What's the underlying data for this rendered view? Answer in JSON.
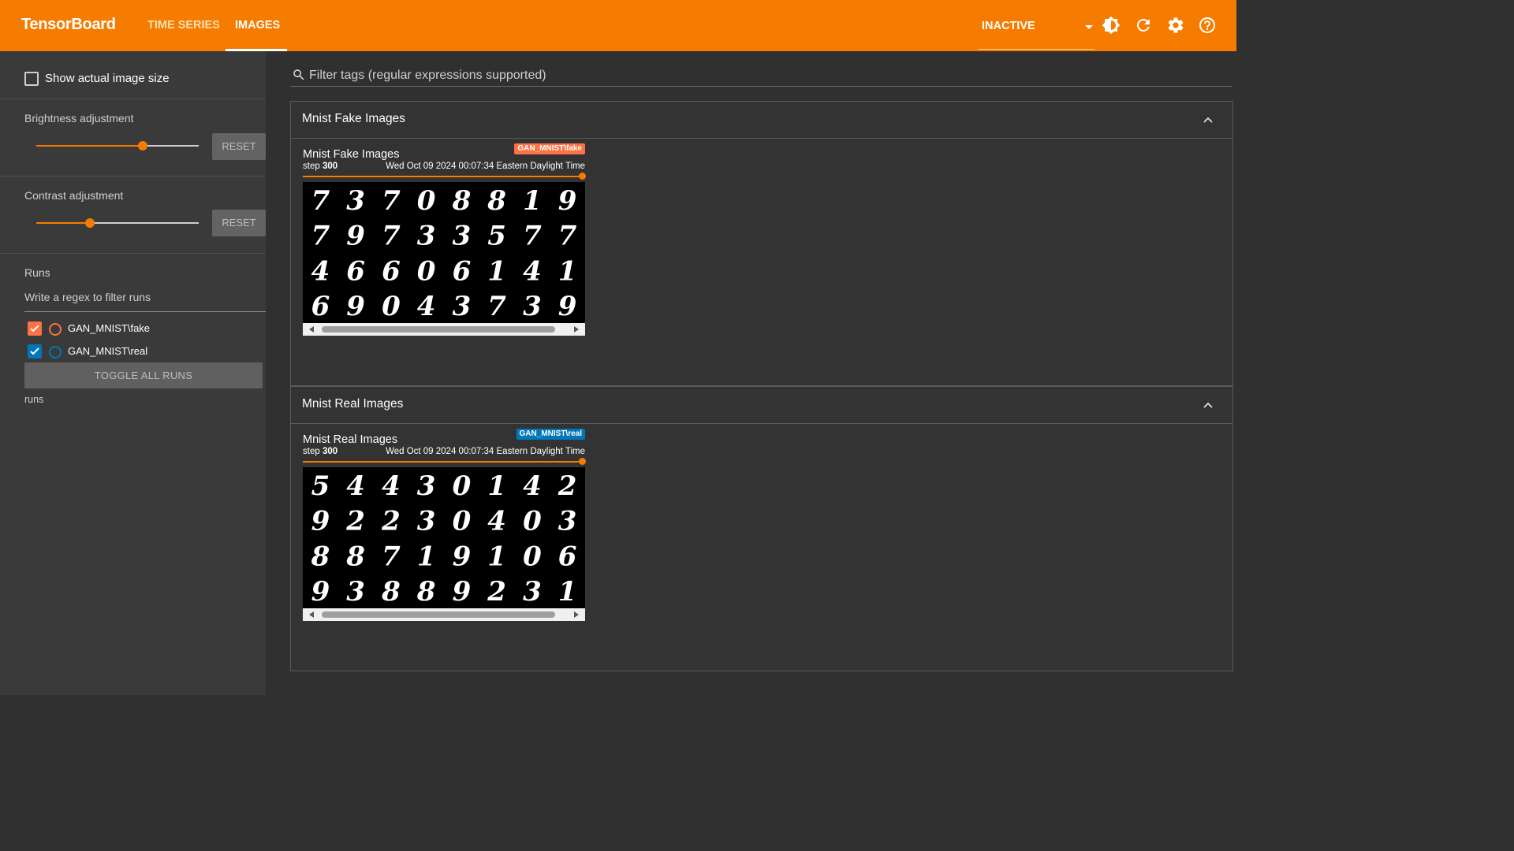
{
  "topbar": {
    "brand": "TensorBoard",
    "tabs": [
      "TIME SERIES",
      "IMAGES"
    ],
    "active_tab": "IMAGES",
    "reload_status": "INACTIVE",
    "icons": [
      "theme-toggle-icon",
      "refresh-icon",
      "settings-icon",
      "help-icon"
    ]
  },
  "sidebar": {
    "show_actual_size_label": "Show actual image size",
    "show_actual_size_checked": false,
    "brightness": {
      "label": "Brightness adjustment",
      "value": 0.65,
      "reset_label": "RESET"
    },
    "contrast": {
      "label": "Contrast adjustment",
      "value": 0.33,
      "reset_label": "RESET"
    },
    "runs": {
      "title": "Runs",
      "filter_placeholder": "Write a regex to filter runs",
      "items": [
        {
          "name": "GAN_MNIST\\fake",
          "checked": true,
          "color": "#ff7043"
        },
        {
          "name": "GAN_MNIST\\real",
          "checked": true,
          "color": "#0077bb"
        }
      ],
      "toggle_label": "TOGGLE ALL RUNS",
      "footer": "runs"
    }
  },
  "main": {
    "filter_placeholder": "Filter tags (regular expressions supported)",
    "groups": [
      {
        "title": "Mnist Fake Images",
        "card": {
          "title": "Mnist Fake Images",
          "run": "GAN_MNIST\\fake",
          "run_color": "#ff7043",
          "step_label": "step",
          "step": "300",
          "timestamp": "Wed Oct 09 2024 00:07:34 Eastern Daylight Time",
          "digits": [
            [
              "7",
              "3",
              "7",
              "0",
              "8",
              "8",
              "1",
              "9"
            ],
            [
              "7",
              "9",
              "7",
              "3",
              "3",
              "5",
              "7",
              "7"
            ],
            [
              "4",
              "6",
              "6",
              "0",
              "6",
              "1",
              "4",
              "1"
            ],
            [
              "6",
              "9",
              "0",
              "4",
              "3",
              "7",
              "3",
              "9"
            ]
          ]
        }
      },
      {
        "title": "Mnist Real Images",
        "card": {
          "title": "Mnist Real Images",
          "run": "GAN_MNIST\\real",
          "run_color": "#0077bb",
          "step_label": "step",
          "step": "300",
          "timestamp": "Wed Oct 09 2024 00:07:34 Eastern Daylight Time",
          "digits": [
            [
              "5",
              "4",
              "4",
              "3",
              "0",
              "1",
              "4",
              "2"
            ],
            [
              "9",
              "2",
              "2",
              "3",
              "0",
              "4",
              "0",
              "3"
            ],
            [
              "8",
              "8",
              "7",
              "1",
              "9",
              "1",
              "0",
              "6"
            ],
            [
              "9",
              "3",
              "8",
              "8",
              "9",
              "2",
              "3",
              "1"
            ]
          ]
        }
      }
    ]
  }
}
